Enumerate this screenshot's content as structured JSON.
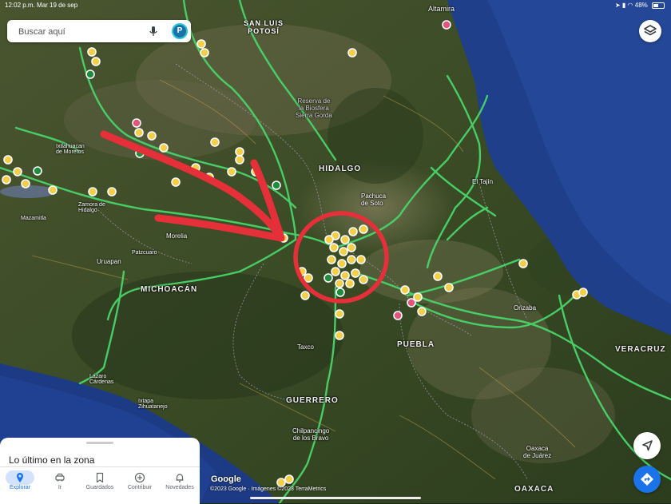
{
  "status": {
    "time": "12:02 p.m.",
    "date": "Mar 19 de sep",
    "battery": "48%"
  },
  "search": {
    "placeholder": "Buscar aquí",
    "avatar_letter": "P"
  },
  "places": {
    "san_luis_potosi": "SAN LUIS\nPOTOSÍ",
    "altamira": "Altamira",
    "reserva": "Reserva de\nla Biosfera\nSierra Gorda",
    "hidalgo": "HIDALGO",
    "pachuca": "Pachuca\nde Soto",
    "el_tajin": "El Tajín",
    "ixtlahuacan": "Ixtlahuacan\nde Moretos",
    "zamora": "Zamora de\nHidalgo",
    "mazamitla": "Mazamitla",
    "morelia": "Morelia",
    "patzcuaro": "Patzcuaro",
    "uruapan": "Uruapan",
    "michoacan": "MICHOACÁN",
    "puebla": "PUEBLA",
    "orizaba": "Orizaba",
    "veracruz": "VERACRUZ",
    "taxco": "Taxco",
    "lazaro": "Lázaro\nCárdenas",
    "ixtapa": "Ixtapa\nZihuatanejo",
    "guerrero": "GUERRERO",
    "chilpancingo": "Chilpancingo\nde los Bravo",
    "oaxaca_juarez": "Oaxaca\nde Juárez",
    "oaxaca": "OAXACA"
  },
  "sheet": {
    "title": "Lo último en la zona",
    "tabs": [
      {
        "label": "Explorar",
        "icon": "pin-icon"
      },
      {
        "label": "Ir",
        "icon": "car-icon"
      },
      {
        "label": "Guardados",
        "icon": "bookmark-icon"
      },
      {
        "label": "Contribuir",
        "icon": "plus-circle-icon"
      },
      {
        "label": "Novedades",
        "icon": "bell-icon"
      }
    ]
  },
  "attribution": {
    "logo": "Google",
    "copyright": "©2023 Google · Imágenes ©2023 TerraMetrics"
  },
  "colors": {
    "water": "#1f3f8a",
    "land": "#3b4a25",
    "highway": "#49d46a",
    "annotation": "#e5303a",
    "marker": "#f6cf4a",
    "accent": "#1a73e8"
  }
}
